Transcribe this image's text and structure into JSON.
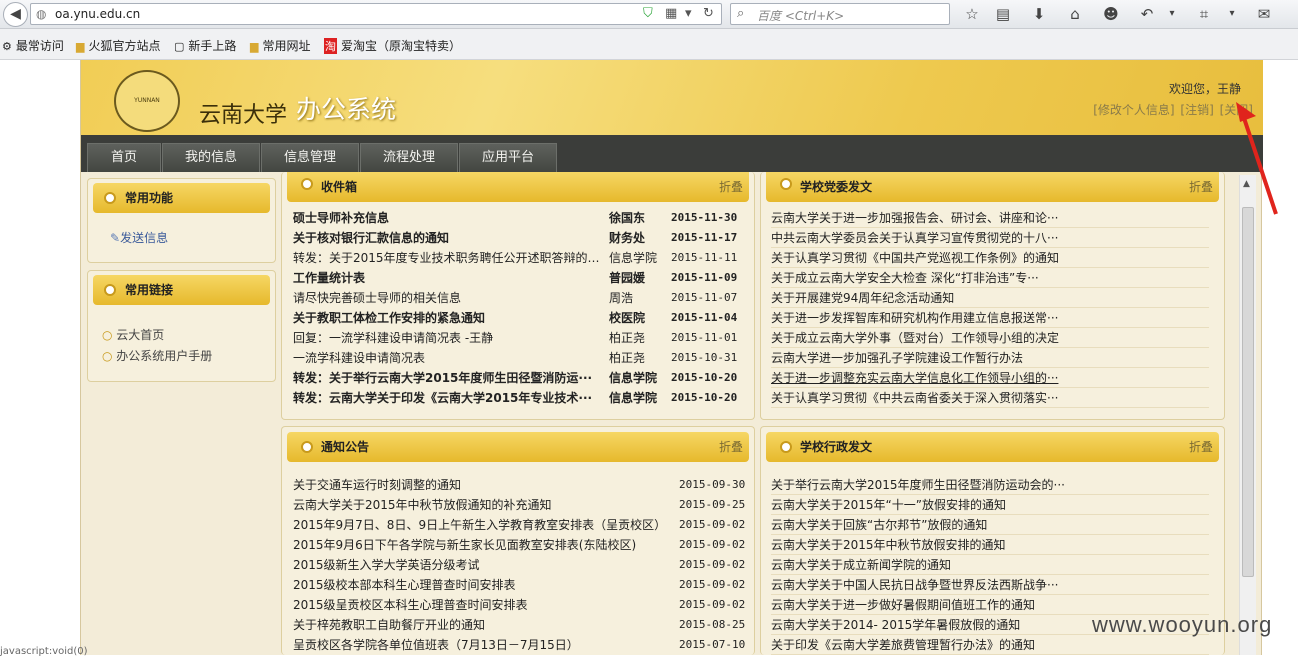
{
  "browser": {
    "url": "oa.ynu.edu.cn",
    "search_placeholder": "百度 <Ctrl+K>",
    "status": "javascript:void(0)"
  },
  "bookmarks": [
    {
      "label": "最常访问"
    },
    {
      "label": "火狐官方站点"
    },
    {
      "label": "新手上路"
    },
    {
      "label": "常用网址"
    },
    {
      "label": "爱淘宝（原淘宝特卖）"
    }
  ],
  "header": {
    "logo_text": "YUNNAN UNIVERSITY",
    "school": "云南大学",
    "system": "办公系统",
    "welcome": "欢迎您，王静",
    "links": [
      "[修改个人信息]",
      "[注销]",
      "[关闭]"
    ]
  },
  "menu": [
    "首页",
    "我的信息",
    "信息管理",
    "流程处理",
    "应用平台"
  ],
  "sidebar": {
    "common_title": "常用功能",
    "send_message": "发送信息",
    "links_title": "常用链接",
    "links": [
      "云大首页",
      "办公系统用户手册"
    ]
  },
  "fold_label": "折叠",
  "inbox": {
    "title": "收件箱",
    "rows": [
      {
        "t": "硕士导师补充信息",
        "s": "徐国东",
        "d": "2015-11-30",
        "bold": true
      },
      {
        "t": "关于核对银行汇款信息的通知",
        "s": "财务处",
        "d": "2015-11-17",
        "bold": true
      },
      {
        "t": "转发：关于2015年度专业技术职务聘任公开述职答辩的通知",
        "s": "信息学院",
        "d": "2015-11-11",
        "bold": false
      },
      {
        "t": "工作量统计表",
        "s": "普园媛",
        "d": "2015-11-09",
        "bold": true
      },
      {
        "t": "请尽快完善硕士导师的相关信息",
        "s": "周浩",
        "d": "2015-11-07",
        "bold": false
      },
      {
        "t": "关于教职工体检工作安排的紧急通知",
        "s": "校医院",
        "d": "2015-11-04",
        "bold": true
      },
      {
        "t": "回复：一流学科建设申请简况表 -王静",
        "s": "柏正尧",
        "d": "2015-11-01",
        "bold": false
      },
      {
        "t": "一流学科建设申请简况表",
        "s": "柏正尧",
        "d": "2015-10-31",
        "bold": false
      },
      {
        "t": "转发：关于举行云南大学2015年度师生田径暨消防运···",
        "s": "信息学院",
        "d": "2015-10-20",
        "bold": true
      },
      {
        "t": "转发：云南大学关于印发《云南大学2015年专业技术···",
        "s": "信息学院",
        "d": "2015-10-20",
        "bold": true
      }
    ]
  },
  "party": {
    "title": "学校党委发文",
    "rows": [
      "云南大学关于进一步加强报告会、研讨会、讲座和论···",
      "中共云南大学委员会关于认真学习宣传贯彻党的十八···",
      "关于认真学习贯彻《中国共产党巡视工作条例》的通知",
      "关于成立云南大学安全大检查 深化“打非治违”专···",
      "关于开展建党94周年纪念活动通知",
      "关于进一步发挥智库和研究机构作用建立信息报送常···",
      "关于成立云南大学外事（暨对台）工作领导小组的决定",
      "云南大学进一步加强孔子学院建设工作暂行办法",
      "关于进一步调整充实云南大学信息化工作领导小组的···",
      "关于认真学习贯彻《中共云南省委关于深入贯彻落实···"
    ]
  },
  "notice": {
    "title": "通知公告",
    "rows": [
      {
        "t": "关于交通车运行时刻调整的通知",
        "d": "2015-09-30"
      },
      {
        "t": "云南大学关于2015年中秋节放假通知的补充通知",
        "d": "2015-09-25"
      },
      {
        "t": "2015年9月7日、8日、9日上午新生入学教育教室安排表（呈贡校区）",
        "d": "2015-09-02"
      },
      {
        "t": "2015年9月6日下午各学院与新生家长见面教室安排表(东陆校区)",
        "d": "2015-09-02"
      },
      {
        "t": "2015级新生入学大学英语分级考试",
        "d": "2015-09-02"
      },
      {
        "t": "2015级校本部本科生心理普查时间安排表",
        "d": "2015-09-02"
      },
      {
        "t": "2015级呈贡校区本科生心理普查时间安排表",
        "d": "2015-09-02"
      },
      {
        "t": "关于梓苑教职工自助餐厅开业的通知",
        "d": "2015-08-25"
      },
      {
        "t": "呈贡校区各学院各单位值班表（7月13日－7月15日）",
        "d": "2015-07-10"
      }
    ]
  },
  "admin": {
    "title": "学校行政发文",
    "rows": [
      "关于举行云南大学2015年度师生田径暨消防运动会的···",
      "云南大学关于2015年“十一”放假安排的通知",
      "云南大学关于回族“古尔邦节”放假的通知",
      "云南大学关于2015年中秋节放假安排的通知",
      "云南大学关于成立新闻学院的通知",
      "云南大学关于中国人民抗日战争暨世界反法西斯战争···",
      "云南大学关于进一步做好暑假期间值班工作的通知",
      "云南大学关于2014- 2015学年暑假放假的通知",
      "关于印发《云南大学差旅费管理暂行办法》的通知"
    ]
  },
  "watermark": "www.wooyun.org",
  "colors": {
    "header_gold": "#f1cd55",
    "menu_dark": "#3b3d3a",
    "panel_bg": "#f6f0dd"
  }
}
